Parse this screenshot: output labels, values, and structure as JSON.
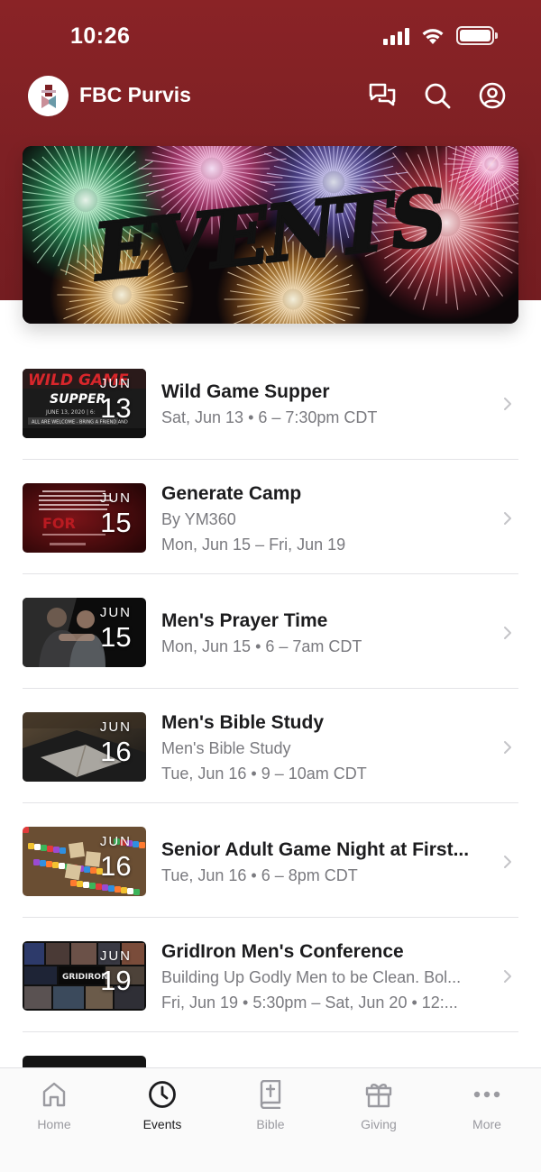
{
  "status_bar": {
    "time": "10:26"
  },
  "app_bar": {
    "title": "FBC Purvis"
  },
  "banner": {
    "text": "EVENTS"
  },
  "events": [
    {
      "title": "Wild Game Supper",
      "subtitle": "",
      "when": "Sat, Jun 13 • 6 – 7:30pm CDT",
      "month": "JUN",
      "day": "13"
    },
    {
      "title": "Generate Camp",
      "subtitle": "By YM360",
      "when": "Mon, Jun 15 – Fri, Jun 19",
      "month": "JUN",
      "day": "15"
    },
    {
      "title": "Men's Prayer Time",
      "subtitle": "",
      "when": "Mon, Jun 15 • 6 – 7am CDT",
      "month": "JUN",
      "day": "15"
    },
    {
      "title": "Men's Bible Study",
      "subtitle": "Men's Bible Study",
      "when": "Tue, Jun 16 • 9 – 10am CDT",
      "month": "JUN",
      "day": "16"
    },
    {
      "title": "Senior Adult Game Night at First...",
      "subtitle": "",
      "when": "Tue, Jun 16 • 6 – 8pm CDT",
      "month": "JUN",
      "day": "16"
    },
    {
      "title": "GridIron Men's Conference",
      "subtitle": "Building Up Godly Men to be Clean. Bol...",
      "when": "Fri, Jun 19 • 5:30pm – Sat, Jun 20 • 12:...",
      "month": "JUN",
      "day": "19"
    }
  ],
  "thumb_text": {
    "wild_game": "WILD GAME",
    "supper": "SUPPER",
    "supper_date": "JUNE 13, 2020 | 6:",
    "supper_note": "ALL ARE WELCOME - BRING A FRIEND AND",
    "gridiron": "GRIDIRON"
  },
  "tabs": [
    {
      "label": "Home",
      "icon": "home-icon",
      "active": false
    },
    {
      "label": "Events",
      "icon": "clock-icon",
      "active": true
    },
    {
      "label": "Bible",
      "icon": "bible-icon",
      "active": false
    },
    {
      "label": "Giving",
      "icon": "gift-icon",
      "active": false
    },
    {
      "label": "More",
      "icon": "more-icon",
      "active": false
    }
  ],
  "colors": {
    "header": "#7d2024",
    "tab_active": "#1c1c1e",
    "tab_inactive": "#9a9aa0"
  }
}
